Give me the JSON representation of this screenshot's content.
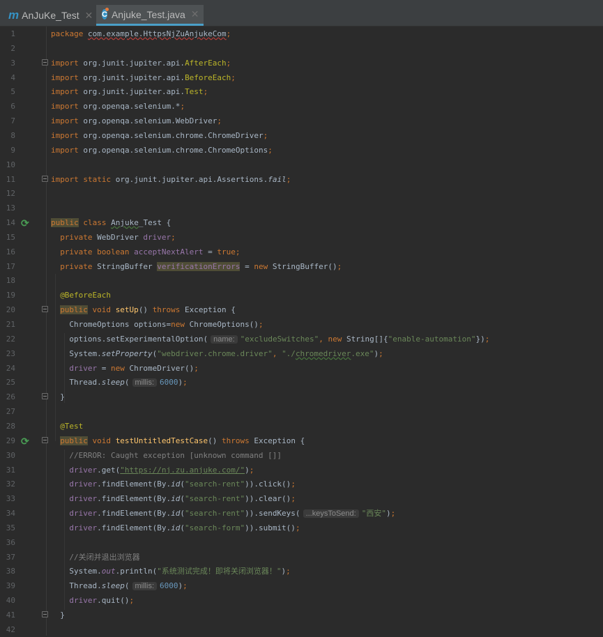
{
  "tabs": [
    {
      "label": "AnJuKe_Test",
      "icon": "maven-module-icon",
      "active": false
    },
    {
      "label": "Anjuke_Test.java",
      "icon": "java-class-icon",
      "active": true
    }
  ],
  "colors": {
    "keyword": "#cc7832",
    "string": "#6a8759",
    "number": "#6897bb",
    "field": "#9876aa",
    "annotation": "#bbb529",
    "comment": "#808080",
    "background": "#2b2b2b"
  },
  "line_count": 42,
  "gutter": {
    "run_icons": [
      14,
      29
    ],
    "fold_markers": [
      3,
      11,
      20,
      26,
      29,
      41
    ]
  },
  "lines": [
    {
      "n": 1,
      "i": 0,
      "t": [
        [
          "package ",
          "kw"
        ],
        [
          "com.example.HttpsNjZuAnjukeCom",
          "plain errw"
        ],
        [
          ";",
          "kw"
        ]
      ]
    },
    {
      "n": 2,
      "i": 0,
      "t": []
    },
    {
      "n": 3,
      "i": 0,
      "t": [
        [
          "import ",
          "kw"
        ],
        [
          "org.junit.jupiter.api.",
          "plain"
        ],
        [
          "AfterEach",
          "ann"
        ],
        [
          ";",
          "kw"
        ]
      ]
    },
    {
      "n": 4,
      "i": 0,
      "t": [
        [
          "import ",
          "kw"
        ],
        [
          "org.junit.jupiter.api.",
          "plain"
        ],
        [
          "BeforeEach",
          "ann"
        ],
        [
          ";",
          "kw"
        ]
      ]
    },
    {
      "n": 5,
      "i": 0,
      "t": [
        [
          "import ",
          "kw"
        ],
        [
          "org.junit.jupiter.api.",
          "plain"
        ],
        [
          "Test",
          "ann"
        ],
        [
          ";",
          "kw"
        ]
      ]
    },
    {
      "n": 6,
      "i": 0,
      "t": [
        [
          "import ",
          "kw"
        ],
        [
          "org.openqa.selenium.*",
          "plain"
        ],
        [
          ";",
          "kw"
        ]
      ]
    },
    {
      "n": 7,
      "i": 0,
      "t": [
        [
          "import ",
          "kw"
        ],
        [
          "org.openqa.selenium.WebDriver",
          "plain"
        ],
        [
          ";",
          "kw"
        ]
      ]
    },
    {
      "n": 8,
      "i": 0,
      "t": [
        [
          "import ",
          "kw"
        ],
        [
          "org.openqa.selenium.chrome.ChromeDriver",
          "plain"
        ],
        [
          ";",
          "kw"
        ]
      ]
    },
    {
      "n": 9,
      "i": 0,
      "t": [
        [
          "import ",
          "kw"
        ],
        [
          "org.openqa.selenium.chrome.ChromeOptions",
          "plain"
        ],
        [
          ";",
          "kw"
        ]
      ]
    },
    {
      "n": 10,
      "i": 0,
      "t": []
    },
    {
      "n": 11,
      "i": 0,
      "t": [
        [
          "import static ",
          "kw"
        ],
        [
          "org.junit.jupiter.api.Assertions.",
          "plain"
        ],
        [
          "fail",
          "plain ital"
        ],
        [
          ";",
          "kw"
        ]
      ]
    },
    {
      "n": 12,
      "i": 0,
      "t": []
    },
    {
      "n": 13,
      "i": 0,
      "t": []
    },
    {
      "n": 14,
      "i": 0,
      "t": [
        [
          "public",
          "kw hl"
        ],
        [
          " class ",
          "kw"
        ],
        [
          "Anjuke",
          "plain warnw"
        ],
        [
          "_Test {",
          "plain"
        ]
      ]
    },
    {
      "n": 15,
      "i": 1,
      "t": [
        [
          "private ",
          "kw"
        ],
        [
          "WebDriver ",
          "plain"
        ],
        [
          "driver",
          "field"
        ],
        [
          ";",
          "kw"
        ]
      ]
    },
    {
      "n": 16,
      "i": 1,
      "t": [
        [
          "private boolean ",
          "kw"
        ],
        [
          "acceptNextAlert",
          "field"
        ],
        [
          " = ",
          "plain"
        ],
        [
          "true;",
          "kw"
        ]
      ]
    },
    {
      "n": 17,
      "i": 1,
      "t": [
        [
          "private ",
          "kw"
        ],
        [
          "StringBuffer ",
          "plain"
        ],
        [
          "verificationErrors",
          "field hl"
        ],
        [
          " = ",
          "plain"
        ],
        [
          "new ",
          "kw"
        ],
        [
          "StringBuffer()",
          "plain"
        ],
        [
          ";",
          "kw"
        ]
      ]
    },
    {
      "n": 18,
      "i": 0,
      "t": []
    },
    {
      "n": 19,
      "i": 1,
      "t": [
        [
          "@BeforeEach",
          "ann"
        ]
      ]
    },
    {
      "n": 20,
      "i": 1,
      "t": [
        [
          "public",
          "kw hl"
        ],
        [
          " void ",
          "kw"
        ],
        [
          "setUp",
          "meth"
        ],
        [
          "() ",
          "plain"
        ],
        [
          "throws ",
          "kw"
        ],
        [
          "Exception {",
          "plain"
        ]
      ]
    },
    {
      "n": 21,
      "i": 2,
      "t": [
        [
          "ChromeOptions options=",
          "plain"
        ],
        [
          "new ",
          "kw"
        ],
        [
          "ChromeOptions()",
          "plain"
        ],
        [
          ";",
          "kw"
        ]
      ]
    },
    {
      "n": 22,
      "i": 2,
      "t": [
        [
          "options.setExperimentalOption(",
          "plain"
        ],
        [
          "name:",
          "hint"
        ],
        [
          "\"excludeSwitches\"",
          "str"
        ],
        [
          ", new ",
          "kw"
        ],
        [
          "String[]{",
          "plain"
        ],
        [
          "\"enable-automation\"",
          "str"
        ],
        [
          "})",
          "plain"
        ],
        [
          ";",
          "kw"
        ]
      ]
    },
    {
      "n": 23,
      "i": 2,
      "t": [
        [
          "System.",
          "plain"
        ],
        [
          "setProperty",
          "plain ital"
        ],
        [
          "(",
          "plain"
        ],
        [
          "\"webdriver.chrome.driver\"",
          "str"
        ],
        [
          ", ",
          "kw"
        ],
        [
          "\"./",
          "str"
        ],
        [
          "chromedriver",
          "str warnw"
        ],
        [
          ".exe\"",
          "str"
        ],
        [
          ")",
          "plain"
        ],
        [
          ";",
          "kw"
        ]
      ]
    },
    {
      "n": 24,
      "i": 2,
      "t": [
        [
          "driver",
          "field"
        ],
        [
          " = ",
          "plain"
        ],
        [
          "new ",
          "kw"
        ],
        [
          "ChromeDriver()",
          "plain"
        ],
        [
          ";",
          "kw"
        ]
      ]
    },
    {
      "n": 25,
      "i": 2,
      "t": [
        [
          "Thread.",
          "plain"
        ],
        [
          "sleep",
          "plain ital"
        ],
        [
          "(",
          "plain"
        ],
        [
          "millis:",
          "hint"
        ],
        [
          "6000",
          "num"
        ],
        [
          ")",
          "plain"
        ],
        [
          ";",
          "kw"
        ]
      ]
    },
    {
      "n": 26,
      "i": 1,
      "t": [
        [
          "}",
          "plain"
        ]
      ]
    },
    {
      "n": 27,
      "i": 0,
      "t": []
    },
    {
      "n": 28,
      "i": 1,
      "t": [
        [
          "@Test",
          "ann"
        ]
      ]
    },
    {
      "n": 29,
      "i": 1,
      "t": [
        [
          "public",
          "kw hl"
        ],
        [
          " void ",
          "kw"
        ],
        [
          "testUntitledTestCase",
          "meth"
        ],
        [
          "() ",
          "plain"
        ],
        [
          "throws ",
          "kw"
        ],
        [
          "Exception {",
          "plain"
        ]
      ]
    },
    {
      "n": 30,
      "i": 2,
      "t": [
        [
          "//ERROR: Caught exception [unknown command []]",
          "cmt"
        ]
      ]
    },
    {
      "n": 31,
      "i": 2,
      "t": [
        [
          "driver",
          "field"
        ],
        [
          ".get(",
          "plain"
        ],
        [
          "\"https://nj.zu.anjuke.com/\"",
          "str link"
        ],
        [
          ")",
          "plain"
        ],
        [
          ";",
          "kw"
        ]
      ]
    },
    {
      "n": 32,
      "i": 2,
      "t": [
        [
          "driver",
          "field"
        ],
        [
          ".findElement(By.",
          "plain"
        ],
        [
          "id",
          "plain ital"
        ],
        [
          "(",
          "plain"
        ],
        [
          "\"search-rent\"",
          "str"
        ],
        [
          ")).click()",
          "plain"
        ],
        [
          ";",
          "kw"
        ]
      ]
    },
    {
      "n": 33,
      "i": 2,
      "t": [
        [
          "driver",
          "field"
        ],
        [
          ".findElement(By.",
          "plain"
        ],
        [
          "id",
          "plain ital"
        ],
        [
          "(",
          "plain"
        ],
        [
          "\"search-rent\"",
          "str"
        ],
        [
          ")).clear()",
          "plain"
        ],
        [
          ";",
          "kw"
        ]
      ]
    },
    {
      "n": 34,
      "i": 2,
      "t": [
        [
          "driver",
          "field"
        ],
        [
          ".findElement(By.",
          "plain"
        ],
        [
          "id",
          "plain ital"
        ],
        [
          "(",
          "plain"
        ],
        [
          "\"search-rent\"",
          "str"
        ],
        [
          ")).sendKeys(",
          "plain"
        ],
        [
          "...keysToSend:",
          "hint"
        ],
        [
          "\"西安\"",
          "str"
        ],
        [
          ")",
          "plain"
        ],
        [
          ";",
          "kw"
        ]
      ]
    },
    {
      "n": 35,
      "i": 2,
      "t": [
        [
          "driver",
          "field"
        ],
        [
          ".findElement(By.",
          "plain"
        ],
        [
          "id",
          "plain ital"
        ],
        [
          "(",
          "plain"
        ],
        [
          "\"search-form\"",
          "str"
        ],
        [
          ")).submit()",
          "plain"
        ],
        [
          ";",
          "kw"
        ]
      ]
    },
    {
      "n": 36,
      "i": 0,
      "t": []
    },
    {
      "n": 37,
      "i": 2,
      "t": [
        [
          "//关闭并退出浏览器",
          "cmt"
        ]
      ]
    },
    {
      "n": 38,
      "i": 2,
      "t": [
        [
          "System.",
          "plain"
        ],
        [
          "out",
          "fieldit"
        ],
        [
          ".println(",
          "plain"
        ],
        [
          "\"系统测试完成！即将关闭浏览器！\"",
          "str"
        ],
        [
          ")",
          "plain"
        ],
        [
          ";",
          "kw"
        ]
      ]
    },
    {
      "n": 39,
      "i": 2,
      "t": [
        [
          "Thread.",
          "plain"
        ],
        [
          "sleep",
          "plain ital"
        ],
        [
          "(",
          "plain"
        ],
        [
          "millis:",
          "hint"
        ],
        [
          "6000",
          "num"
        ],
        [
          ")",
          "plain"
        ],
        [
          ";",
          "kw"
        ]
      ]
    },
    {
      "n": 40,
      "i": 2,
      "t": [
        [
          "driver",
          "field"
        ],
        [
          ".quit()",
          "plain"
        ],
        [
          ";",
          "kw"
        ]
      ]
    },
    {
      "n": 41,
      "i": 1,
      "t": [
        [
          "}",
          "plain"
        ]
      ]
    },
    {
      "n": 42,
      "i": 0,
      "t": []
    }
  ]
}
